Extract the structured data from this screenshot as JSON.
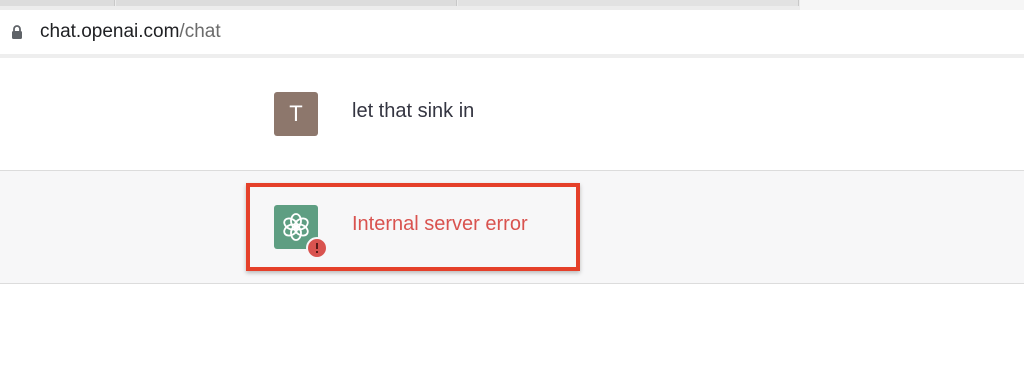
{
  "browser": {
    "url_host": "chat.openai.com",
    "url_path": "/chat"
  },
  "conversation": {
    "user_message": {
      "avatar_letter": "T",
      "text": "let that sink in"
    },
    "assistant_message": {
      "text": "Internal server error"
    }
  },
  "colors": {
    "user_avatar": "#8d776c",
    "assistant_avatar": "#5e9e82",
    "error_text": "#d9534f",
    "highlight_border": "#e5402a"
  },
  "icons": {
    "lock": "lock-icon",
    "assistant_logo": "openai-logo-icon",
    "error_indicator": "error-indicator-icon"
  }
}
